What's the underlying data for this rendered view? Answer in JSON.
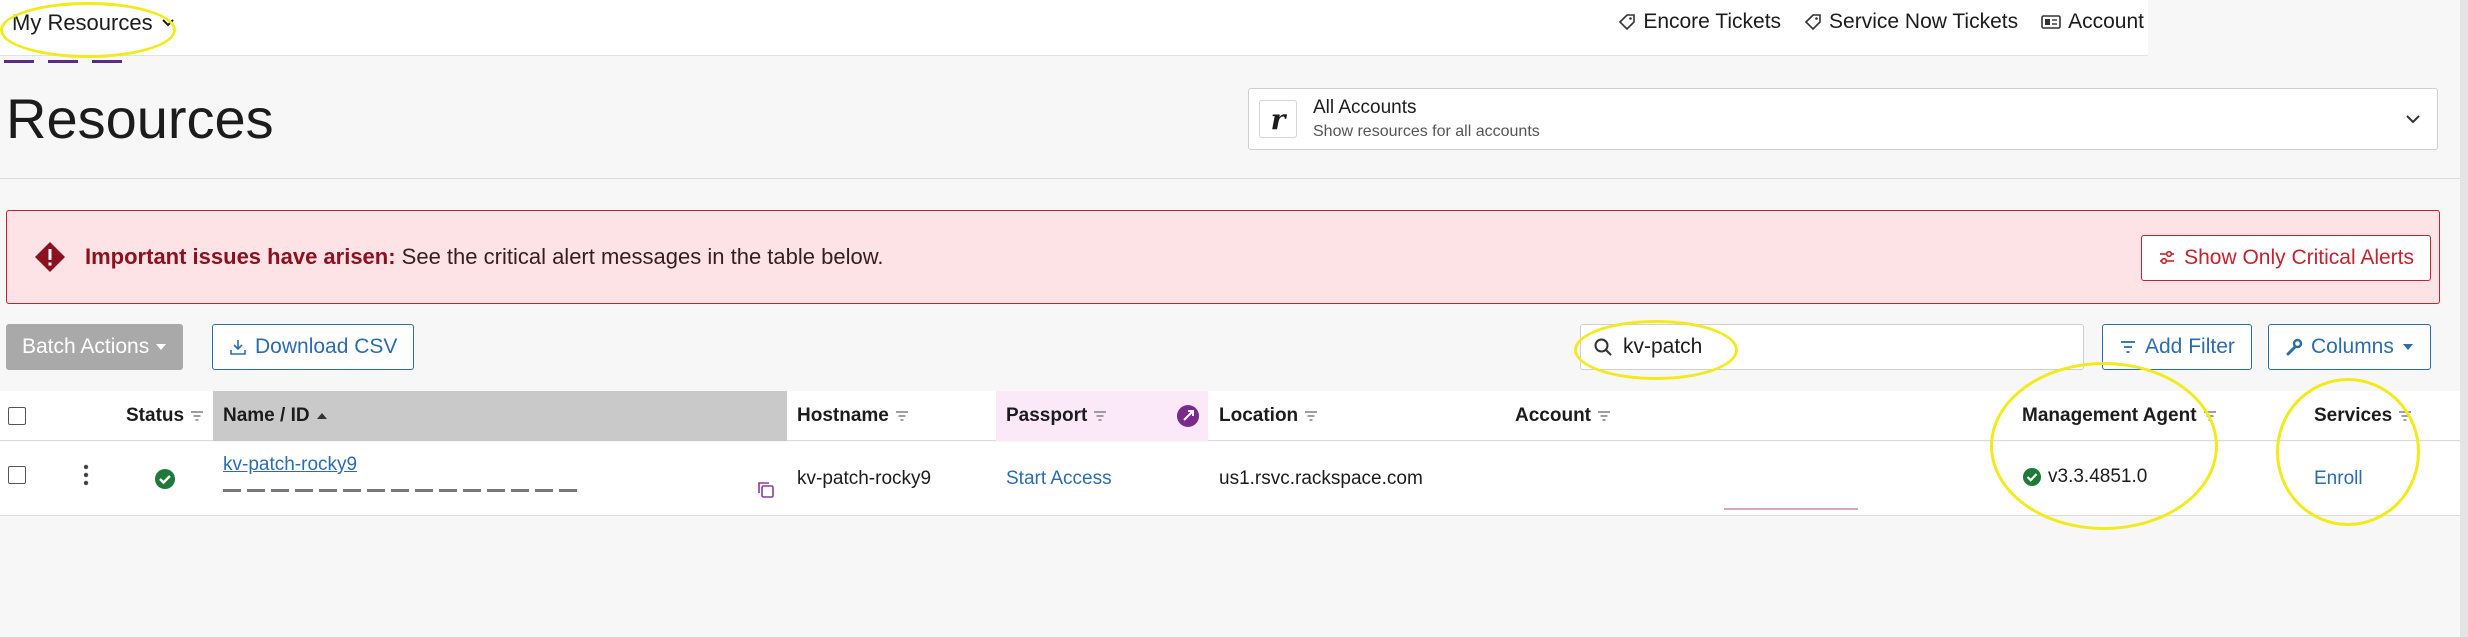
{
  "nav": {
    "my_resources": "My Resources",
    "links": [
      {
        "label": "Encore Tickets",
        "icon": "ticket-icon"
      },
      {
        "label": "Service Now Tickets",
        "icon": "ticket-icon"
      },
      {
        "label": "Account",
        "icon": "id-card-icon"
      }
    ]
  },
  "page": {
    "title": "Resources"
  },
  "account_selector": {
    "logo_letter": "r",
    "name": "All Accounts",
    "subtitle": "Show resources for all accounts"
  },
  "alert": {
    "bold": "Important issues have arisen:",
    "message": " See the critical alert messages in the table below.",
    "button": "Show Only Critical Alerts"
  },
  "toolbar": {
    "batch_actions": "Batch Actions",
    "download_csv": "Download CSV",
    "search_value": "kv-patch",
    "add_filter": "Add Filter",
    "columns": "Columns"
  },
  "table": {
    "headers": {
      "status": "Status",
      "name": "Name / ID",
      "hostname": "Hostname",
      "passport": "Passport",
      "location": "Location",
      "account": "Account",
      "agent": "Management Agent",
      "services": "Services"
    },
    "rows": [
      {
        "name": "kv-patch-rocky9",
        "hostname": "kv-patch-rocky9",
        "passport": "Start Access",
        "location": "us1.rsvc.rackspace.com",
        "account": "",
        "agent": "v3.3.4851.0",
        "services": "Enroll"
      }
    ]
  },
  "colors": {
    "link": "#2b6cb0",
    "alert_border": "#c8202f",
    "alert_bg": "#fde3e6",
    "status_ok": "#1f7a3a",
    "highlight": "#f3ea1c"
  }
}
